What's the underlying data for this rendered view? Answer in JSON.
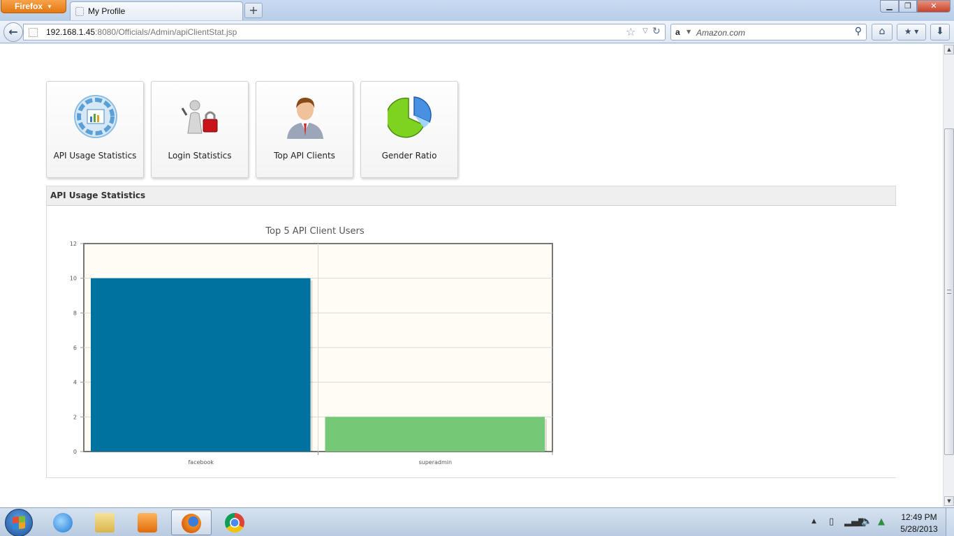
{
  "browser": {
    "menu_button": "Firefox",
    "tab_title": "My Profile",
    "new_tab": "+",
    "url_host": "192.168.1.45",
    "url_rest": ":8080/Officials/Admin/apiClientStat.jsp",
    "search_placeholder": "Amazon.com",
    "search_engine_icon": "a"
  },
  "tiles": [
    {
      "label": "API Usage Statistics",
      "icon": "api-stats-icon"
    },
    {
      "label": "Login Statistics",
      "icon": "login-lock-icon"
    },
    {
      "label": "Top API Clients",
      "icon": "businessman-icon"
    },
    {
      "label": "Gender Ratio",
      "icon": "pie-chart-icon"
    }
  ],
  "section": {
    "title": "API Usage Statistics"
  },
  "chart_data": {
    "type": "bar",
    "title": "Top 5 API Client Users",
    "categories": [
      "facebook",
      "superadmin"
    ],
    "values": [
      10,
      2
    ],
    "colors": [
      "#0072a0",
      "#75c876"
    ],
    "ylim": [
      0,
      12
    ],
    "yticks": [
      0,
      2,
      4,
      6,
      8,
      10,
      12
    ],
    "xlabel": "",
    "ylabel": "",
    "grid": true,
    "background": "#fffcf5"
  },
  "taskbar": {
    "apps": [
      "internet-explorer-icon",
      "windows-explorer-icon",
      "media-player-icon",
      "firefox-icon",
      "chrome-icon"
    ],
    "time": "12:49 PM",
    "date": "5/28/2013"
  }
}
